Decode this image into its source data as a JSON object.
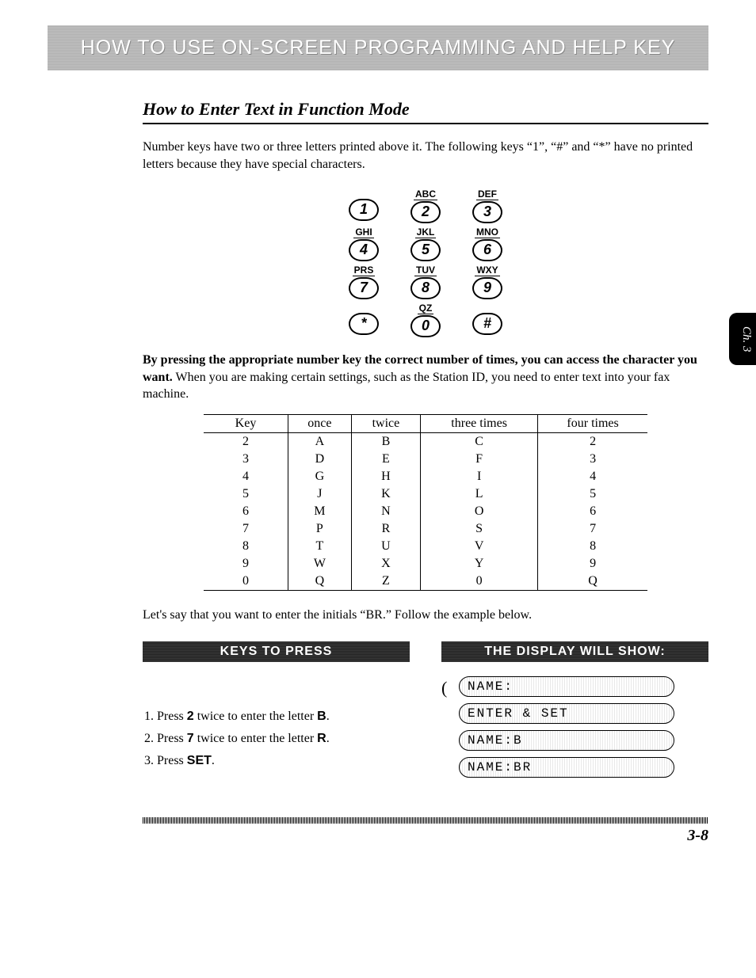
{
  "banner": "HOW TO USE ON-SCREEN PROGRAMMING AND HELP KEY",
  "sideTab": "Ch. 3",
  "section_title": "How to Enter Text in Function Mode",
  "intro": "Number keys have two or three letters printed above it.  The following keys “1”, “#” and “*” have no printed letters because they have special characters.",
  "keypad": [
    [
      {
        "label": "",
        "key": "1"
      },
      {
        "label": "ABC",
        "key": "2"
      },
      {
        "label": "DEF",
        "key": "3"
      }
    ],
    [
      {
        "label": "GHI",
        "key": "4"
      },
      {
        "label": "JKL",
        "key": "5"
      },
      {
        "label": "MNO",
        "key": "6"
      }
    ],
    [
      {
        "label": "PRS",
        "key": "7"
      },
      {
        "label": "TUV",
        "key": "8"
      },
      {
        "label": "WXY",
        "key": "9"
      }
    ],
    [
      {
        "label": "",
        "key": "*"
      },
      {
        "label": "QZ",
        "key": "0"
      },
      {
        "label": "",
        "key": "#"
      }
    ]
  ],
  "para2_lead": "By pressing the appropriate number key the correct number of times, you can access the character you want.",
  "para2_rest": " When you are making certain settings, such as the Station ID, you need to enter text into your fax machine.",
  "table": {
    "headers": [
      "Key",
      "once",
      "twice",
      "three times",
      "four times"
    ],
    "rows": [
      [
        "2",
        "A",
        "B",
        "C",
        "2"
      ],
      [
        "3",
        "D",
        "E",
        "F",
        "3"
      ],
      [
        "4",
        "G",
        "H",
        "I",
        "4"
      ],
      [
        "5",
        "J",
        "K",
        "L",
        "5"
      ],
      [
        "6",
        "M",
        "N",
        "O",
        "6"
      ],
      [
        "7",
        "P",
        "R",
        "S",
        "7"
      ],
      [
        "8",
        "T",
        "U",
        "V",
        "8"
      ],
      [
        "9",
        "W",
        "X",
        "Y",
        "9"
      ],
      [
        "0",
        "Q",
        "Z",
        "0",
        "Q"
      ]
    ]
  },
  "example_intro": "Let's say that you want to enter the initials “BR.” Follow the example below.",
  "keys_header": "KEYS TO PRESS",
  "display_header": "THE DISPLAY WILL SHOW:",
  "steps": [
    {
      "pre": "Press ",
      "bold": "2",
      "mid": " twice to enter the letter ",
      "bold2": "B",
      "post": "."
    },
    {
      "pre": "Press ",
      "bold": "7",
      "mid": " twice to enter the letter ",
      "bold2": "R",
      "post": "."
    },
    {
      "pre": "Press ",
      "bold": "SET",
      "mid": "",
      "bold2": "",
      "post": "."
    }
  ],
  "displays": [
    "NAME:",
    "ENTER & SET",
    "NAME:B",
    "NAME:BR"
  ],
  "page_number": "3-8"
}
